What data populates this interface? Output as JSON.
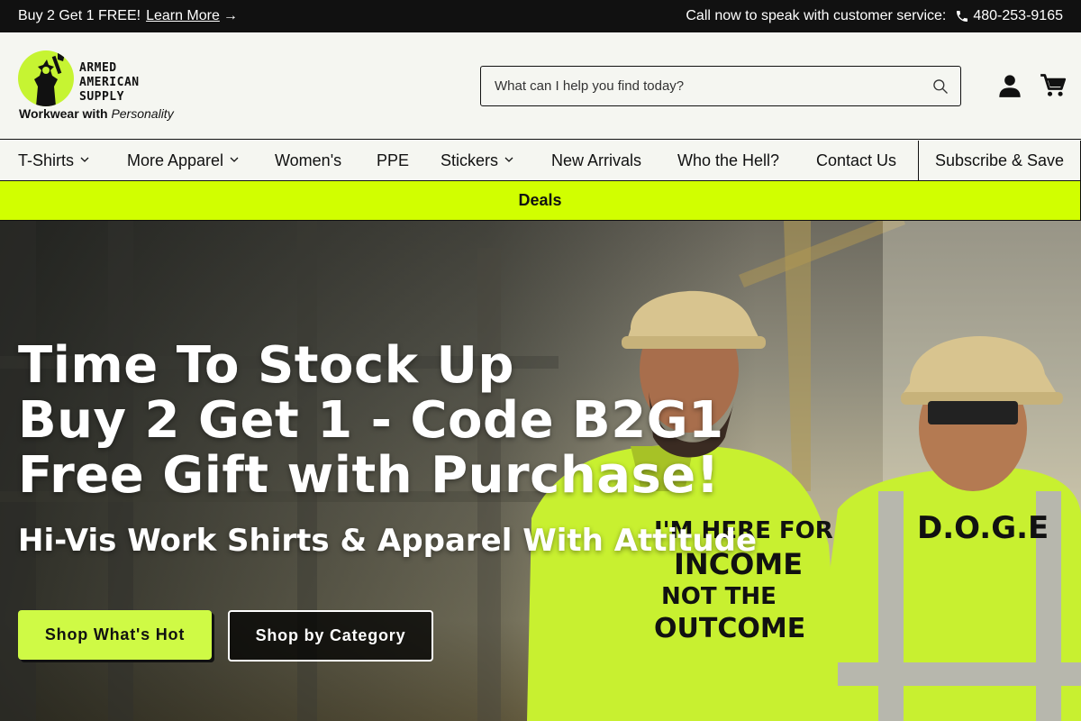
{
  "topbar": {
    "promo_text": "Buy 2 Get 1 FREE!",
    "promo_link": "Learn More",
    "arrow": "→",
    "service_text": "Call now to speak with customer service:",
    "phone": "480-253-9165"
  },
  "logo": {
    "line1": "ARMED",
    "line2": "AMERICAN",
    "line3": "SUPPLY",
    "tagline_bold": "Workwear with",
    "tagline_italic": "Personality"
  },
  "search": {
    "placeholder": "What can I help you find today?"
  },
  "nav": {
    "items": [
      {
        "label": "T-Shirts"
      },
      {
        "label": "More Apparel"
      },
      {
        "label": "Women's"
      },
      {
        "label": "PPE"
      },
      {
        "label": "Stickers"
      },
      {
        "label": "New Arrivals"
      },
      {
        "label": "Who the Hell?"
      },
      {
        "label": "Contact Us"
      }
    ],
    "subscribe": "Subscribe & Save",
    "deals": "Deals"
  },
  "hero": {
    "title_line1": "Time To Stock Up",
    "title_line2": "Buy 2 Get 1 - Code B2G1",
    "title_line3": "Free Gift with Purchase!",
    "subtitle": "Hi-Vis Work Shirts & Apparel With Attitude",
    "btn_primary": "Shop What's Hot",
    "btn_secondary": "Shop by Category",
    "shirt_text_1": "I'M HERE FOR",
    "shirt_text_2": "INCOME",
    "shirt_text_3": "NOT THE",
    "shirt_text_4": "OUTCOME",
    "vest_text": "D.O.G.E"
  },
  "colors": {
    "accent": "#d1ff00",
    "button": "#cffa45",
    "dark": "#111111",
    "background": "#f5f6f1"
  }
}
